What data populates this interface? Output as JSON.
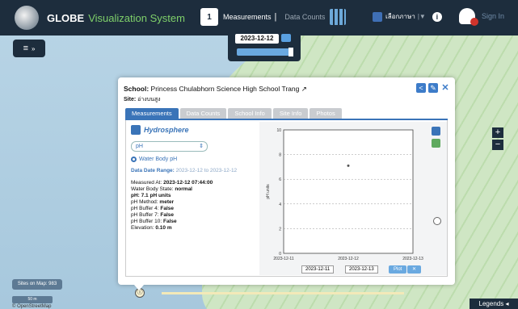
{
  "app": {
    "title_bold": "GLOBE",
    "title_accent": "Visualization System"
  },
  "nav": {
    "calendar_day": "1",
    "measurements": "Measurements",
    "separator": "|",
    "data_counts": "Data Counts"
  },
  "lang": {
    "label": "เลือกภาษา",
    "caret": "|▼"
  },
  "signin": "Sign In",
  "datepanel": {
    "date": "2023-12-12"
  },
  "zoom": {
    "in": "+",
    "out": "−"
  },
  "sites_on_map": "Sites on Map: 983",
  "scale": "50 m",
  "legends": "Legends ◂",
  "osm": "© OpenStreetMap",
  "popup": {
    "school_label": "School:",
    "school_name": "Princess Chulabhorn Science High School Trang",
    "site_label": "Site:",
    "site_name": "อ่างบนสูง",
    "tabs": [
      "Measurements",
      "Data Counts",
      "School Info",
      "Site Info",
      "Photos"
    ],
    "section": "Hydrosphere",
    "select_value": "pH",
    "radio_label": "Water Body pH",
    "range_label": "Data Date Range:",
    "range_value": "2023-12-12 to 2023-12-12",
    "details": [
      {
        "label": "Measured At:",
        "value": "2023-12-12 07:44:00",
        "bold": true
      },
      {
        "label": "Water Body State:",
        "value": "normal",
        "bold": true
      },
      {
        "label": "pH:",
        "value": "7.1 pH units",
        "bold": true,
        "label_bold": true
      },
      {
        "label": "pH Method:",
        "value": "meter",
        "bold": true
      },
      {
        "label": "pH Buffer 4:",
        "value": "False",
        "bold": true
      },
      {
        "label": "pH Buffer 7:",
        "value": "False",
        "bold": true
      },
      {
        "label": "pH Buffer 10:",
        "value": "False",
        "bold": true
      },
      {
        "label": "Elevation:",
        "value": "0.10 m",
        "bold": true
      }
    ],
    "start_date": "2023-12-11",
    "end_date": "2023-12-13",
    "plot_btn": "Plot"
  },
  "chart_data": {
    "type": "scatter",
    "x": [
      "2023-12-12"
    ],
    "y": [
      7.1
    ],
    "xlabel": "",
    "ylabel": "pH units",
    "xticks": [
      "2023-12-11",
      "2023-12-12",
      "2023-12-13"
    ],
    "yticks": [
      0,
      2,
      4,
      6,
      8,
      10
    ],
    "ylim": [
      0,
      10
    ],
    "grid": true
  }
}
